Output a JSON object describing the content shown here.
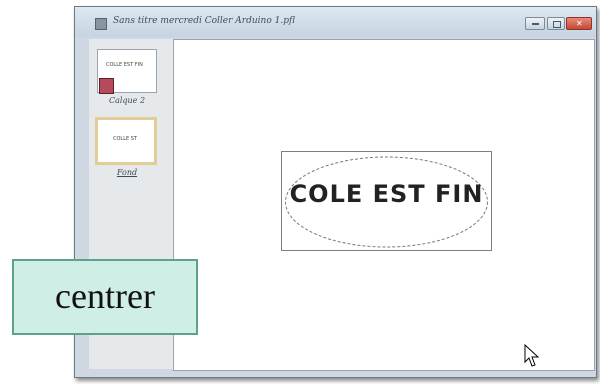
{
  "window": {
    "title": "Sans titre mercredi Coller Arduino 1.pfl",
    "minimize_icon": "minimize-icon",
    "maximize_icon": "maximize-icon",
    "close_icon": "close-icon",
    "close_color": "#c9503c"
  },
  "sidebar": {
    "thumbnails": [
      {
        "mini_text": "COLLE EST FIN",
        "label": "Calque 2",
        "selected": false
      },
      {
        "mini_text": "COLLE ST",
        "label": "Fond",
        "selected": true
      }
    ]
  },
  "canvas": {
    "text": "COLE EST FIN"
  },
  "callout": {
    "text": "centrer",
    "background": "#cfeee6",
    "border": "#5fa28b"
  }
}
